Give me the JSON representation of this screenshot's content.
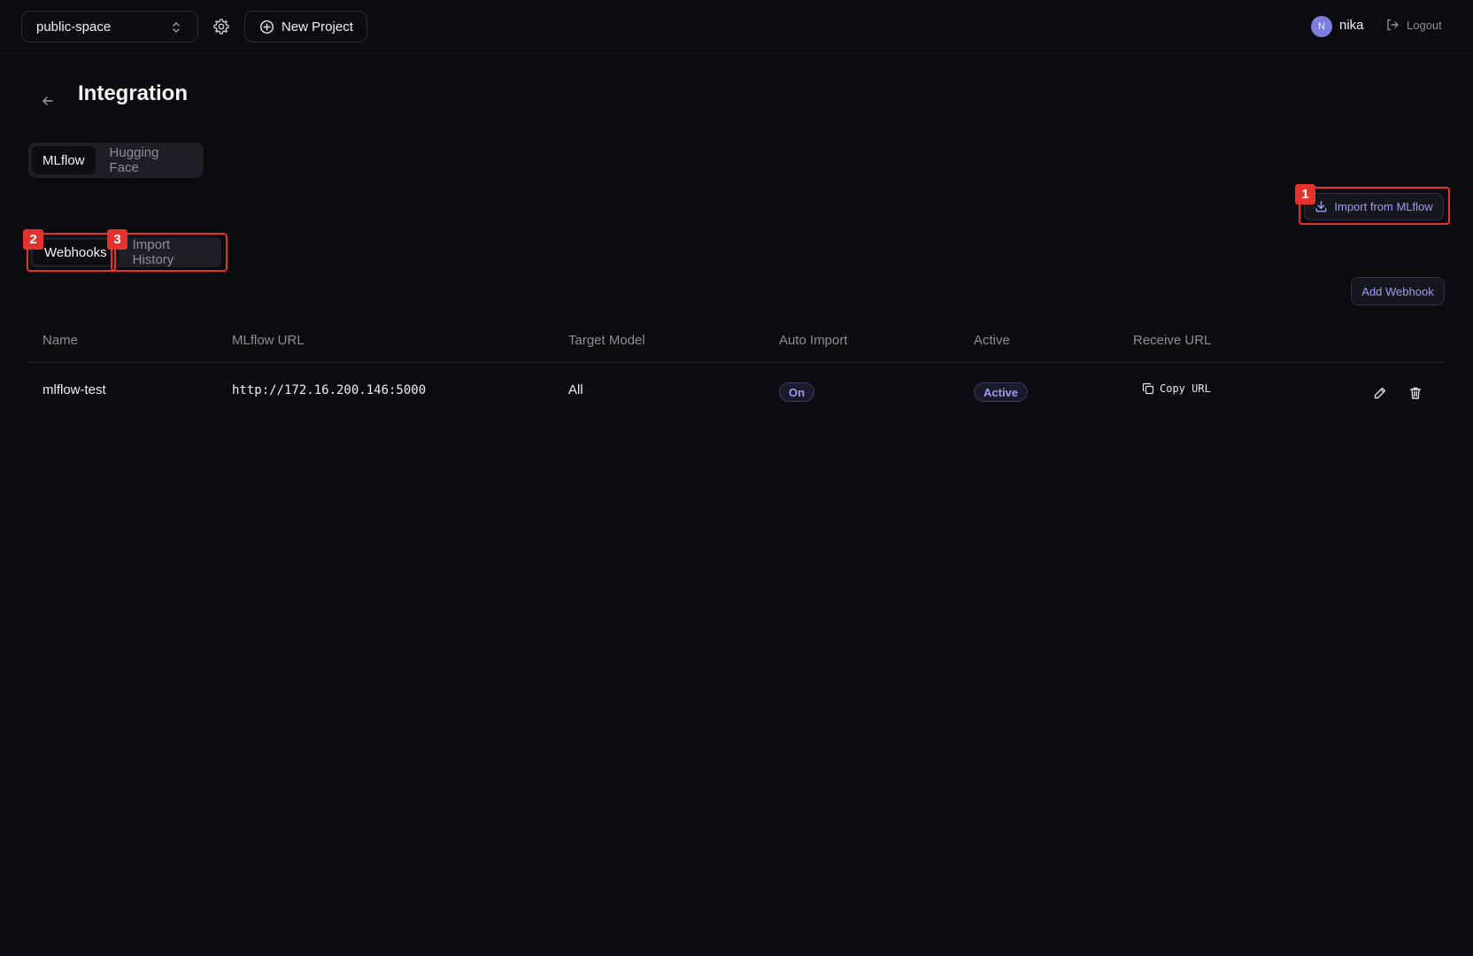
{
  "header": {
    "space_selector": {
      "value": "public-space",
      "icon": "chevron-up-down-icon"
    },
    "settings_icon": "gear-icon",
    "new_project_label": "New Project",
    "user": {
      "initial": "N",
      "name": "nika"
    },
    "logout_label": "Logout"
  },
  "page": {
    "title": "Integration",
    "provider_tabs": [
      {
        "label": "MLflow",
        "active": true
      },
      {
        "label": "Hugging Face",
        "active": false
      }
    ],
    "import_button_label": "Import from MLflow",
    "sub_tabs": [
      {
        "label": "Webhooks",
        "active": true
      },
      {
        "label": "Import History",
        "active": false
      }
    ],
    "add_webhook_label": "Add Webhook"
  },
  "table": {
    "columns": [
      "Name",
      "MLflow URL",
      "Target Model",
      "Auto Import",
      "Active",
      "Receive URL"
    ],
    "rows": [
      {
        "name": "mlflow-test",
        "mlflow_url": "http://172.16.200.146:5000",
        "target_model": "All",
        "auto_import": "On",
        "active": "Active",
        "receive_url_label": "Copy URL"
      }
    ]
  },
  "annotations": [
    {
      "number": "1",
      "target": "import-from-mlflow-button"
    },
    {
      "number": "2",
      "target": "tab-webhooks"
    },
    {
      "number": "3",
      "target": "tab-import-history"
    }
  ],
  "colors": {
    "background": "#0b0b10",
    "accent": "#9b9cf2",
    "annotation": "#e5322e",
    "avatar": "#7b7fe0"
  }
}
